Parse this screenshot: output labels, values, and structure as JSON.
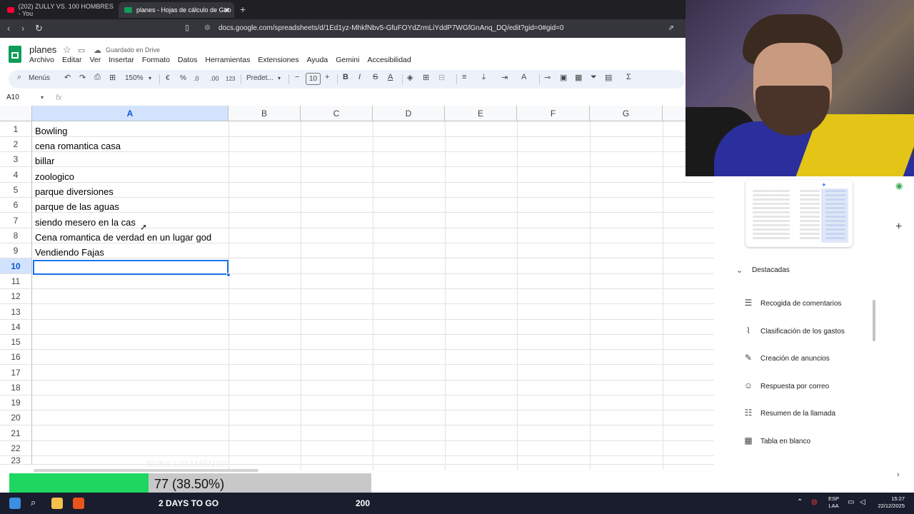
{
  "browser": {
    "tabs": [
      {
        "label": "(202) ZULLY VS. 100 HOMBRES - You"
      },
      {
        "label": "planes - Hojas de cálculo de Goo"
      }
    ],
    "url": "docs.google.com/spreadsheets/d/1Ed1yz-MhkfNbv5-GfuFOYdZrmLiYddP7WGfGnAnq_DQ/edit?gid=0#gid=0"
  },
  "sheet": {
    "title": "planes",
    "saved_status": "Guardado en Drive",
    "menus": [
      "Archivo",
      "Editar",
      "Ver",
      "Insertar",
      "Formato",
      "Datos",
      "Herramientas",
      "Extensiones",
      "Ayuda",
      "Gemini",
      "Accesibilidad"
    ],
    "toolbar": {
      "menus_label": "Menús",
      "zoom": "150%",
      "currency": "€",
      "percent": "%",
      "dec_less": ".0",
      "dec_more": ".00",
      "number_format": "123",
      "font": "Predet...",
      "font_size": "10"
    },
    "name_box": "A10",
    "fx_label": "fx",
    "columns": [
      "A",
      "B",
      "C",
      "D",
      "E",
      "F",
      "G"
    ],
    "rows": [
      "1",
      "2",
      "3",
      "4",
      "5",
      "6",
      "7",
      "8",
      "9",
      "10",
      "11",
      "12",
      "13",
      "14",
      "15",
      "16",
      "17",
      "18",
      "19",
      "20",
      "21",
      "22",
      "23"
    ],
    "cells": [
      "Bowling",
      "cena romantica casa",
      "billar",
      "zoologico",
      "parque diversiones",
      "parque de las aguas",
      "siendo mesero en la cas",
      "Cena romantica de verdad en un lugar god",
      "Vendiendo Fajas"
    ]
  },
  "side_panel": {
    "section_title": "Destacadas",
    "items": [
      {
        "label": "Recogida de comentarios",
        "icon": "feedback-icon"
      },
      {
        "label": "Clasificación de los gastos",
        "icon": "chart-icon"
      },
      {
        "label": "Creación de anuncios",
        "icon": "wand-icon"
      },
      {
        "label": "Respuesta por correo",
        "icon": "people-icon"
      },
      {
        "label": "Resumen de la llamada",
        "icon": "list-add-icon"
      },
      {
        "label": "Tabla en blanco",
        "icon": "table-icon"
      }
    ]
  },
  "overlay": {
    "progress_text": "77 (38.50%)",
    "progress_fraction": 0.385,
    "watermark": "SUBS LIGAMENTO",
    "days_text": "2 DAYS TO GO",
    "goal": "200"
  },
  "taskbar": {
    "lang_top": "ESP",
    "lang_bottom": "LAA",
    "time": "15:27",
    "date": "22/12/2025"
  },
  "colors": {
    "progress_green": "#1ed760",
    "selection_blue": "#1a73e8",
    "sheets_green": "#0f9d58"
  }
}
